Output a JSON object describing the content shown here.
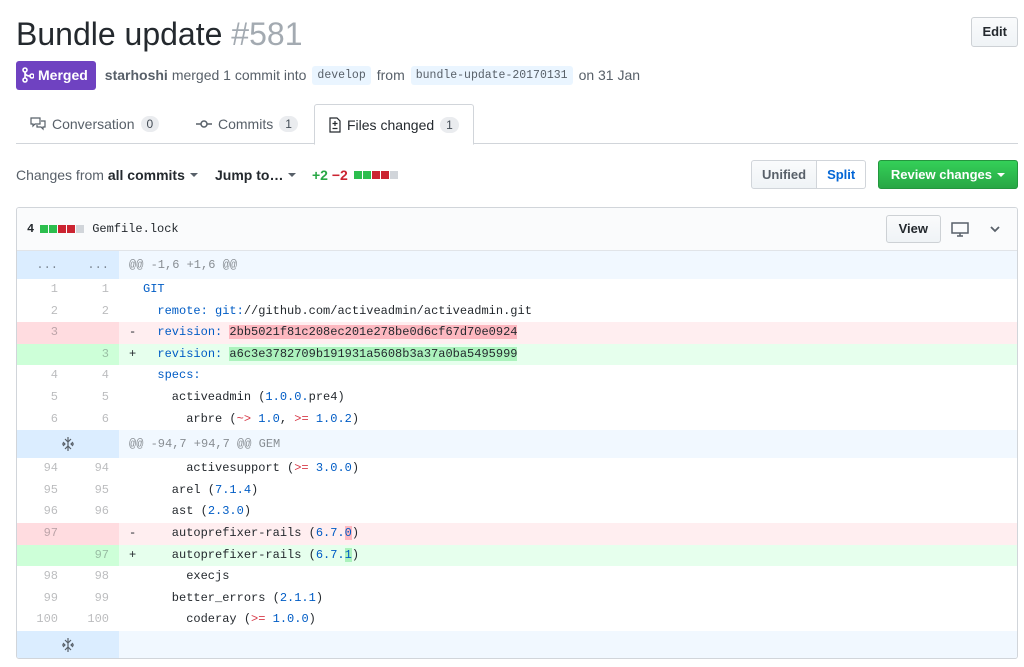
{
  "pr": {
    "title": "Bundle update",
    "number": "#581",
    "edit_label": "Edit",
    "state_label": "Merged",
    "author": "starhoshi",
    "merged_text": "merged 1 commit into",
    "base_branch": "develop",
    "from_text": "from",
    "head_branch": "bundle-update-20170131",
    "date_text": "on 31 Jan"
  },
  "tabs": [
    {
      "label": "Conversation",
      "count": "0"
    },
    {
      "label": "Commits",
      "count": "1"
    },
    {
      "label": "Files changed",
      "count": "1"
    }
  ],
  "toolbar": {
    "changes_prefix": "Changes from",
    "changes_value": "all commits",
    "jump_label": "Jump to…",
    "additions": "+2",
    "deletions": "−2",
    "unified_label": "Unified",
    "split_label": "Split",
    "review_label": "Review changes"
  },
  "file": {
    "change_count": "4",
    "name": "Gemfile.lock",
    "view_label": "View",
    "hunk1": "@@ -1,6 +1,6 @@",
    "hunk1_dots_left": "...",
    "hunk1_dots_right": "...",
    "hunk2": "@@ -94,7 +94,7 @@ GEM"
  },
  "colors": {
    "merged": "#6f42c1",
    "review_button": "#28a745",
    "deleted_line": "#ffeef0",
    "added_line": "#e6ffed"
  }
}
